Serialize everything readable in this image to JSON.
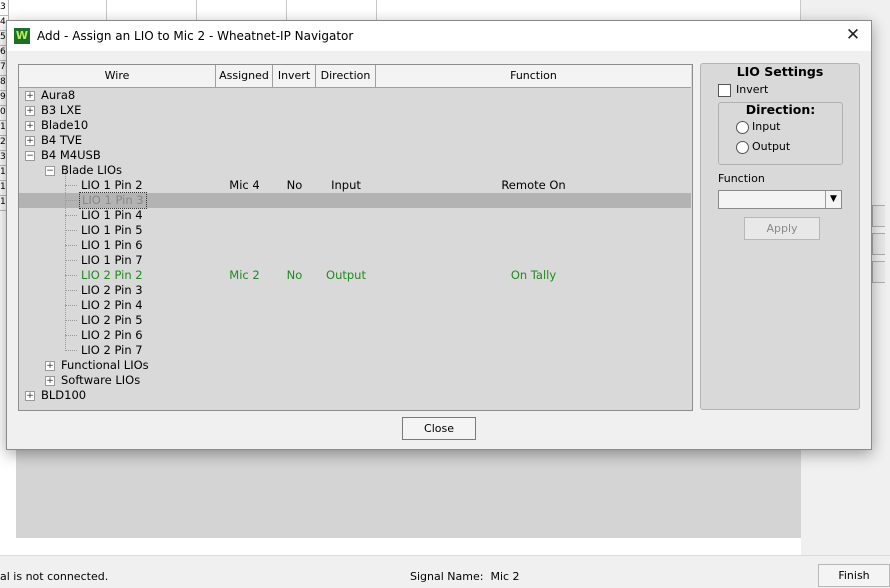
{
  "background": {
    "row_numbers": [
      "3",
      "4",
      "5",
      "6",
      "7",
      "8",
      "9",
      "0",
      "1",
      "2",
      "3",
      "1",
      "1",
      "1"
    ],
    "status_left": "al is not connected.",
    "signal_name_label": "Signal Name:",
    "signal_name_value": "Mic 2",
    "finish_label": "Finish"
  },
  "dialog": {
    "title": "Add - Assign an LIO to Mic 2 - Wheatnet-IP Navigator",
    "icon": "wheatnet-logo-icon",
    "close_label": "Close"
  },
  "table": {
    "columns": [
      "Wire",
      "Assigned",
      "Invert",
      "Direction",
      "Function"
    ],
    "rows": [
      {
        "label": "Aura8",
        "level": 0,
        "expander": "+",
        "assigned": "",
        "invert": "",
        "direction": "",
        "function": ""
      },
      {
        "label": "B3 LXE",
        "level": 0,
        "expander": "+",
        "assigned": "",
        "invert": "",
        "direction": "",
        "function": ""
      },
      {
        "label": "Blade10",
        "level": 0,
        "expander": "+",
        "assigned": "",
        "invert": "",
        "direction": "",
        "function": ""
      },
      {
        "label": "B4 TVE",
        "level": 0,
        "expander": "+",
        "assigned": "",
        "invert": "",
        "direction": "",
        "function": ""
      },
      {
        "label": "B4 M4USB",
        "level": 0,
        "expander": "−",
        "assigned": "",
        "invert": "",
        "direction": "",
        "function": ""
      },
      {
        "label": "Blade LIOs",
        "level": 1,
        "expander": "−",
        "assigned": "",
        "invert": "",
        "direction": "",
        "function": ""
      },
      {
        "label": "LIO 1 Pin 2",
        "level": 2,
        "expander": "",
        "assigned": "Mic 4",
        "invert": "No",
        "direction": "Input",
        "function": "Remote On"
      },
      {
        "label": "LIO 1 Pin 3",
        "level": 2,
        "expander": "",
        "assigned": "",
        "invert": "",
        "direction": "",
        "function": "",
        "state": "selected"
      },
      {
        "label": "LIO 1 Pin 4",
        "level": 2,
        "expander": "",
        "assigned": "",
        "invert": "",
        "direction": "",
        "function": ""
      },
      {
        "label": "LIO 1 Pin 5",
        "level": 2,
        "expander": "",
        "assigned": "",
        "invert": "",
        "direction": "",
        "function": ""
      },
      {
        "label": "LIO 1 Pin 6",
        "level": 2,
        "expander": "",
        "assigned": "",
        "invert": "",
        "direction": "",
        "function": ""
      },
      {
        "label": "LIO 1 Pin 7",
        "level": 2,
        "expander": "",
        "assigned": "",
        "invert": "",
        "direction": "",
        "function": ""
      },
      {
        "label": "LIO 2 Pin 2",
        "level": 2,
        "expander": "",
        "assigned": "Mic 2",
        "invert": "No",
        "direction": "Output",
        "function": "On Tally",
        "state": "green"
      },
      {
        "label": "LIO 2 Pin 3",
        "level": 2,
        "expander": "",
        "assigned": "",
        "invert": "",
        "direction": "",
        "function": ""
      },
      {
        "label": "LIO 2 Pin 4",
        "level": 2,
        "expander": "",
        "assigned": "",
        "invert": "",
        "direction": "",
        "function": ""
      },
      {
        "label": "LIO 2 Pin 5",
        "level": 2,
        "expander": "",
        "assigned": "",
        "invert": "",
        "direction": "",
        "function": ""
      },
      {
        "label": "LIO 2 Pin 6",
        "level": 2,
        "expander": "",
        "assigned": "",
        "invert": "",
        "direction": "",
        "function": ""
      },
      {
        "label": "LIO 2 Pin 7",
        "level": 2,
        "expander": "",
        "assigned": "",
        "invert": "",
        "direction": "",
        "function": ""
      },
      {
        "label": "Functional LIOs",
        "level": 1,
        "expander": "+",
        "assigned": "",
        "invert": "",
        "direction": "",
        "function": ""
      },
      {
        "label": "Software LIOs",
        "level": 1,
        "expander": "+",
        "assigned": "",
        "invert": "",
        "direction": "",
        "function": ""
      },
      {
        "label": "BLD100",
        "level": 0,
        "expander": "+",
        "assigned": "",
        "invert": "",
        "direction": "",
        "function": ""
      }
    ]
  },
  "lio_settings": {
    "title": "LIO Settings",
    "invert_label": "Invert",
    "invert_checked": false,
    "direction_title": "Direction:",
    "direction_options": [
      "Input",
      "Output"
    ],
    "function_label": "Function",
    "function_value": "",
    "apply_label": "Apply"
  },
  "colors": {
    "assigned_green": "#1e8b1e",
    "selection_gray": "#b3b3b3",
    "panel_gray": "#d9d9d9",
    "dialog_bg": "#f0f0f0"
  }
}
